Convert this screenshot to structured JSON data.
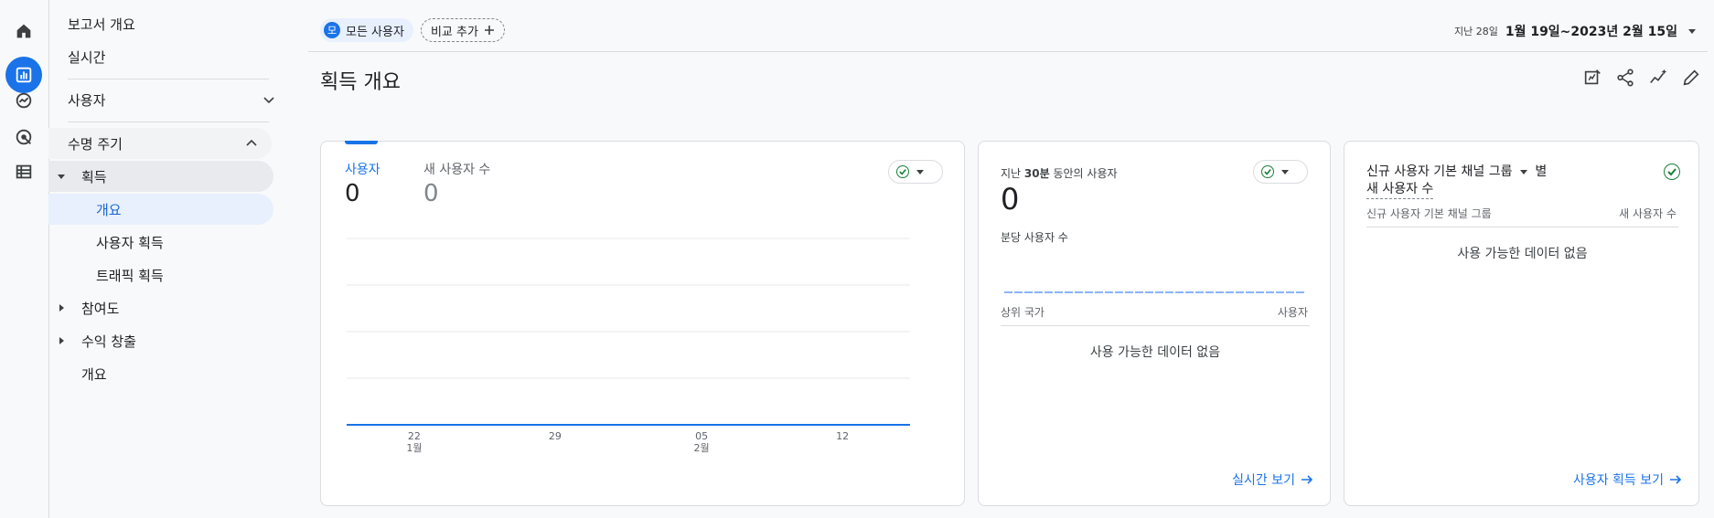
{
  "rail": {
    "icons": [
      "home-icon",
      "reports-icon",
      "explore-icon",
      "advertising-icon",
      "configure-icon"
    ]
  },
  "nav": {
    "report_overview": "보고서 개요",
    "realtime": "실시간",
    "users": "사용자",
    "lifecycle": "수명 주기",
    "acquisition": "획득",
    "acq_overview": "개요",
    "user_acquisition": "사용자 획득",
    "traffic_acquisition": "트래픽 획득",
    "engagement": "참여도",
    "monetization": "수익 창출",
    "overview": "개요"
  },
  "topbar": {
    "segment_badge": "모",
    "segment_label": "모든 사용자",
    "compare_label": "비교 추가",
    "date_prefix": "지난 28일",
    "date_value": "1월 19일~2023년 2월 15일"
  },
  "page": {
    "title": "획득 개요"
  },
  "colors": {
    "accent": "#1a73e8",
    "check": "#188038"
  },
  "card1": {
    "tab_users": "사용자",
    "tab_users_value": "0",
    "tab_new_users": "새 사용자 수",
    "tab_new_users_value": "0",
    "x_ticks": [
      {
        "day": "22",
        "month": "1월"
      },
      {
        "day": "29",
        "month": ""
      },
      {
        "day": "05",
        "month": "2월"
      },
      {
        "day": "12",
        "month": ""
      }
    ]
  },
  "chart_data": {
    "type": "line",
    "categories": [
      "22 1월",
      "29",
      "05 2월",
      "12"
    ],
    "series": [
      {
        "name": "사용자",
        "values": [
          0,
          0,
          0,
          0
        ]
      }
    ],
    "title": "",
    "xlabel": "",
    "ylabel": ""
  },
  "card2": {
    "title_prefix": "지난 ",
    "title_bold": "30분",
    "title_suffix": " 동안의 사용자",
    "value": "0",
    "per_minute": "분당 사용자 수",
    "col_left": "상위 국가",
    "col_right": "사용자",
    "no_data": "사용 가능한 데이터 없음",
    "link": "실시간 보기"
  },
  "card3": {
    "title_line1a": "신규 사용자 기본 채널 그룹",
    "title_line1b": "별",
    "title_line2": "새 사용자 수",
    "col_left": "신규 사용자 기본 채널 그룹",
    "col_right": "새 사용자 수",
    "no_data": "사용 가능한 데이터 없음",
    "link": "사용자 획득 보기"
  }
}
